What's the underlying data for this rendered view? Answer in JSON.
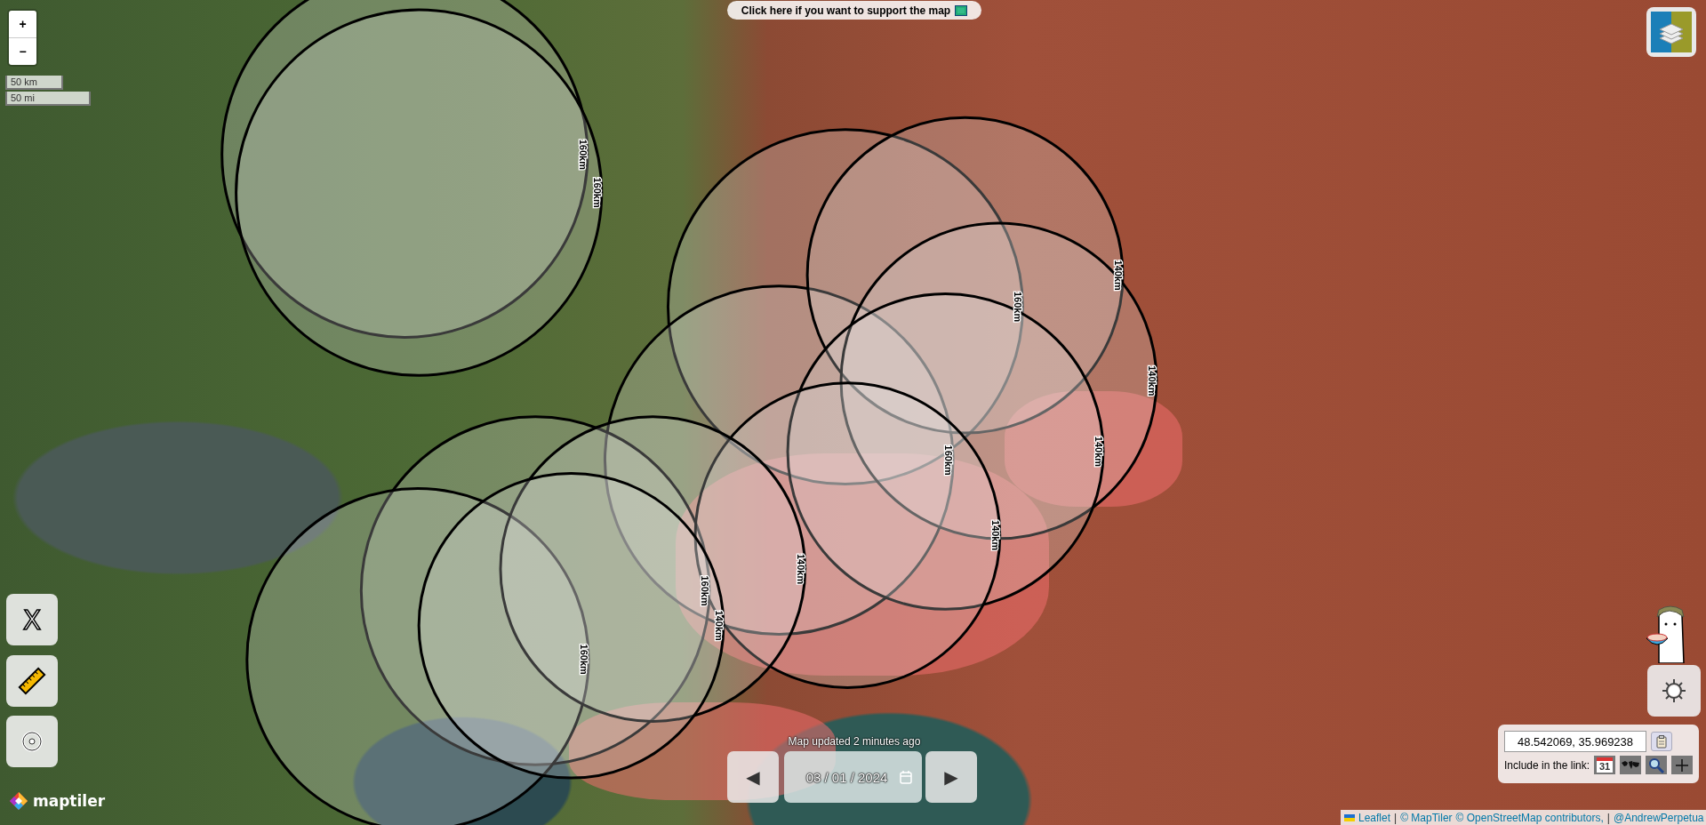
{
  "support_banner": {
    "text": "Click here if you want to support the map"
  },
  "zoom_controls": [
    {
      "label": "+"
    },
    {
      "label": "−"
    }
  ],
  "scale": {
    "metric": "50 km",
    "imperial": "50 mi"
  },
  "tools": {
    "x_button": "X"
  },
  "circles": [
    {
      "label": "160km"
    },
    {
      "label": "160km"
    },
    {
      "label": "160km"
    },
    {
      "label": "160km"
    },
    {
      "label": "160km"
    },
    {
      "label": "160km"
    },
    {
      "label": "140km"
    },
    {
      "label": "140km"
    },
    {
      "label": "140km"
    },
    {
      "label": "140km"
    },
    {
      "label": "140km"
    },
    {
      "label": "140km"
    }
  ],
  "logo": {
    "text": "maptiler"
  },
  "date_bar": {
    "status": "Map updated 2 minutes ago",
    "prev": "◀",
    "date": "03 / 01 / 2024",
    "next": "▶"
  },
  "coordinates": {
    "value": "48.542069, 35.969238",
    "include_label": "Include in the link:",
    "calendar_day": "31"
  },
  "attribution": [
    {
      "text": "Leaflet",
      "kind": "link"
    },
    {
      "text": "|",
      "kind": "text"
    },
    {
      "text": "© MapTiler",
      "kind": "link"
    },
    {
      "text": "© OpenStreetMap contributors,",
      "kind": "link"
    },
    {
      "text": "|",
      "kind": "text"
    },
    {
      "text": "@AndrewPerpetua",
      "kind": "link"
    }
  ]
}
